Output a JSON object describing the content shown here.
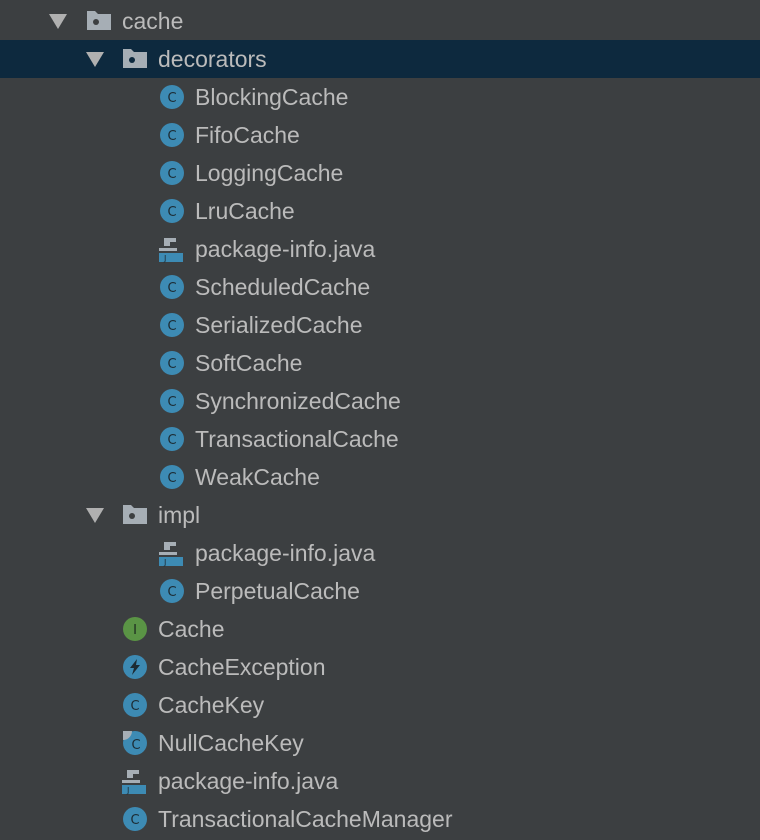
{
  "tree": {
    "items": [
      {
        "label": "cache",
        "kind": "folder",
        "expanded": true,
        "selected": false
      },
      {
        "label": "decorators",
        "kind": "folder",
        "expanded": true,
        "selected": true
      },
      {
        "label": "BlockingCache",
        "kind": "class"
      },
      {
        "label": "FifoCache",
        "kind": "class"
      },
      {
        "label": "LoggingCache",
        "kind": "class"
      },
      {
        "label": "LruCache",
        "kind": "class"
      },
      {
        "label": "package-info.java",
        "kind": "java-file"
      },
      {
        "label": "ScheduledCache",
        "kind": "class"
      },
      {
        "label": "SerializedCache",
        "kind": "class"
      },
      {
        "label": "SoftCache",
        "kind": "class"
      },
      {
        "label": "SynchronizedCache",
        "kind": "class"
      },
      {
        "label": "TransactionalCache",
        "kind": "class"
      },
      {
        "label": "WeakCache",
        "kind": "class"
      },
      {
        "label": "impl",
        "kind": "folder",
        "expanded": true,
        "selected": false
      },
      {
        "label": "package-info.java",
        "kind": "java-file"
      },
      {
        "label": "PerpetualCache",
        "kind": "class"
      },
      {
        "label": "Cache",
        "kind": "interface"
      },
      {
        "label": "CacheException",
        "kind": "exception"
      },
      {
        "label": "CacheKey",
        "kind": "class"
      },
      {
        "label": "NullCacheKey",
        "kind": "class-inner"
      },
      {
        "label": "package-info.java",
        "kind": "java-file"
      },
      {
        "label": "TransactionalCacheManager",
        "kind": "class"
      }
    ]
  },
  "colors": {
    "background": "#3c3f41",
    "selection": "#0d293e",
    "text": "#bbbbbb",
    "class_icon": "#3d8bb4",
    "interface_icon": "#5a9445",
    "folder_icon": "#a6aeb5"
  }
}
